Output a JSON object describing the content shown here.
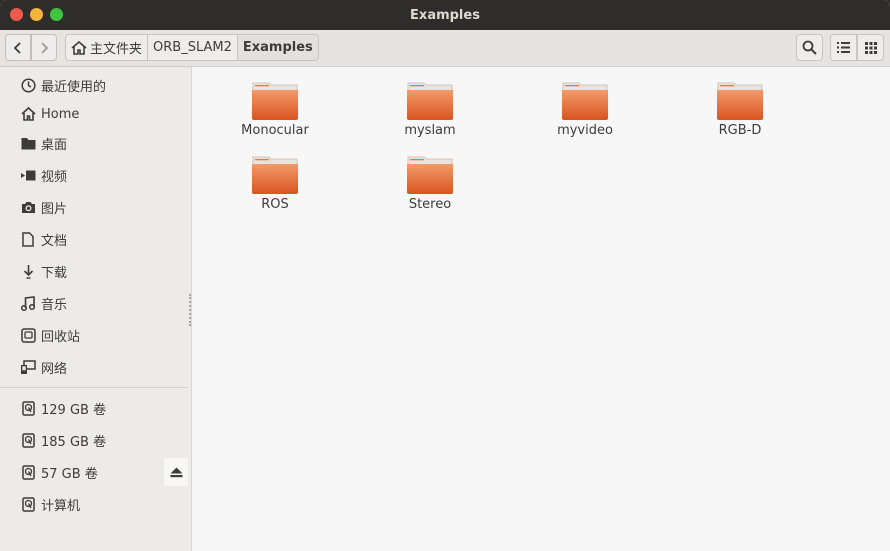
{
  "window": {
    "title": "Examples"
  },
  "breadcrumb": [
    "主文件夹",
    "ORB_SLAM2",
    "Examples"
  ],
  "sidebar": {
    "places": [
      {
        "label": "最近使用的",
        "icon": "clock-icon"
      },
      {
        "label": "Home",
        "icon": "home-icon"
      },
      {
        "label": "桌面",
        "icon": "folder-icon"
      },
      {
        "label": "视频",
        "icon": "video-icon"
      },
      {
        "label": "图片",
        "icon": "camera-icon"
      },
      {
        "label": "文档",
        "icon": "document-icon"
      },
      {
        "label": "下载",
        "icon": "download-icon"
      },
      {
        "label": "音乐",
        "icon": "music-icon"
      },
      {
        "label": "回收站",
        "icon": "trash-icon"
      },
      {
        "label": "网络",
        "icon": "network-icon"
      }
    ],
    "devices": [
      {
        "label": "129 GB 卷",
        "icon": "drive-icon"
      },
      {
        "label": "185 GB 卷",
        "icon": "drive-icon"
      },
      {
        "label": "57 GB 卷",
        "icon": "drive-icon"
      },
      {
        "label": "计算机",
        "icon": "drive-icon"
      }
    ]
  },
  "files": [
    {
      "name": "Monocular"
    },
    {
      "name": "myslam"
    },
    {
      "name": "myvideo"
    },
    {
      "name": "RGB-D"
    },
    {
      "name": "ROS"
    },
    {
      "name": "Stereo"
    }
  ],
  "colors": {
    "folder_top": "#f29a6a",
    "folder_bottom": "#d9541f",
    "titlebar": "#2e2d2b"
  }
}
